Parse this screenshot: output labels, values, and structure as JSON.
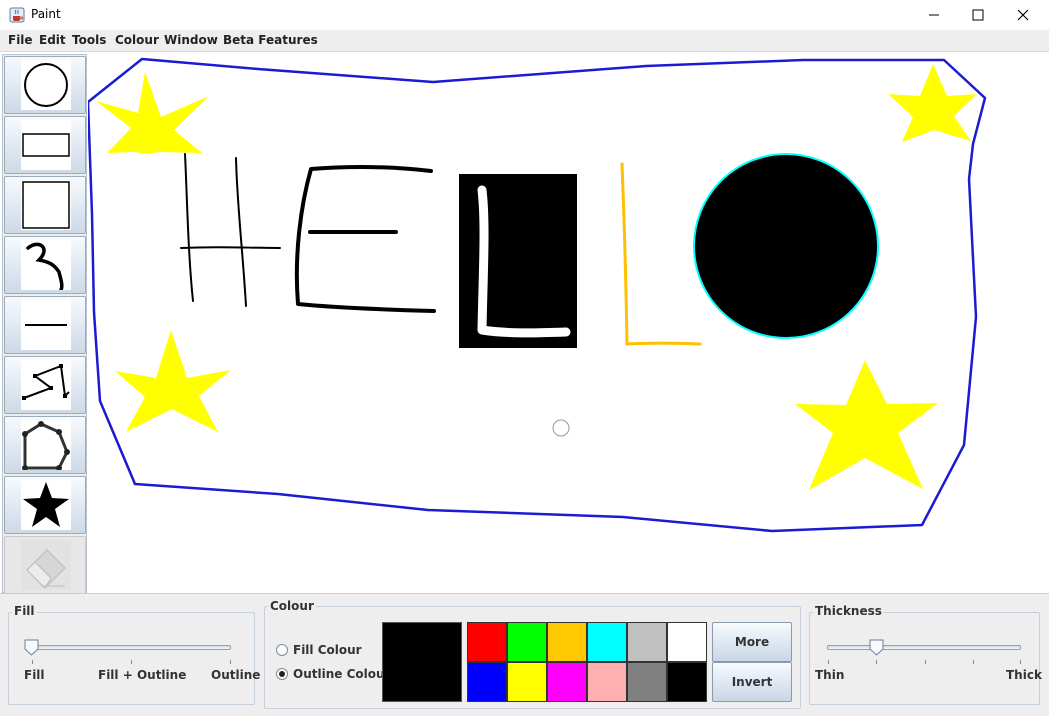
{
  "window": {
    "title": "Paint",
    "icon": "java-cup-icon",
    "controls": [
      "minimize-icon",
      "maximize-icon",
      "close-icon"
    ]
  },
  "menu": [
    "File",
    "Edit",
    "Tools",
    "Colour",
    "Window",
    "Beta Features"
  ],
  "tools": [
    {
      "name": "circle",
      "icon": "circle-tool-icon"
    },
    {
      "name": "rectangle",
      "icon": "rectangle-tool-icon"
    },
    {
      "name": "square",
      "icon": "square-tool-icon"
    },
    {
      "name": "freehand",
      "icon": "freehand-tool-icon"
    },
    {
      "name": "line",
      "icon": "line-tool-icon"
    },
    {
      "name": "polyline",
      "icon": "polyline-tool-icon"
    },
    {
      "name": "polygon",
      "icon": "polygon-tool-icon"
    },
    {
      "name": "star",
      "icon": "star-tool-icon"
    },
    {
      "name": "eraser",
      "icon": "eraser-tool-icon",
      "disabled": true
    }
  ],
  "canvas": {
    "shapes": [
      "blue outline polygon",
      "yellow stars",
      "HELLO drawing",
      "black circle with cyan outline"
    ],
    "colors": {
      "outline": "#1b1bd2",
      "star": "#ffff00",
      "text": "#000000",
      "white_stroke": "#ffffff",
      "l_stroke": "#ffc000",
      "circle_fill": "#000000",
      "circle_outline": "#00ffff"
    }
  },
  "fill": {
    "title": "Fill",
    "labels": [
      "Fill",
      "Fill + Outline",
      "Outline"
    ],
    "value": 0
  },
  "colour": {
    "title": "Colour",
    "radio_fill": "Fill Colour",
    "radio_outline": "Outline Colour",
    "selected": "Outline Colour",
    "current_color": "#000000",
    "palette": [
      "#ff0000",
      "#00ff00",
      "#ffc800",
      "#00ffff",
      "#c0c0c0",
      "#ffffff",
      "#0000ff",
      "#ffff00",
      "#ff00ff",
      "#ffafaf",
      "#808080",
      "#000000"
    ],
    "more_label": "More",
    "invert_label": "Invert"
  },
  "thickness": {
    "title": "Thickness",
    "min_label": "Thin",
    "max_label": "Thick",
    "value": 0.25
  }
}
